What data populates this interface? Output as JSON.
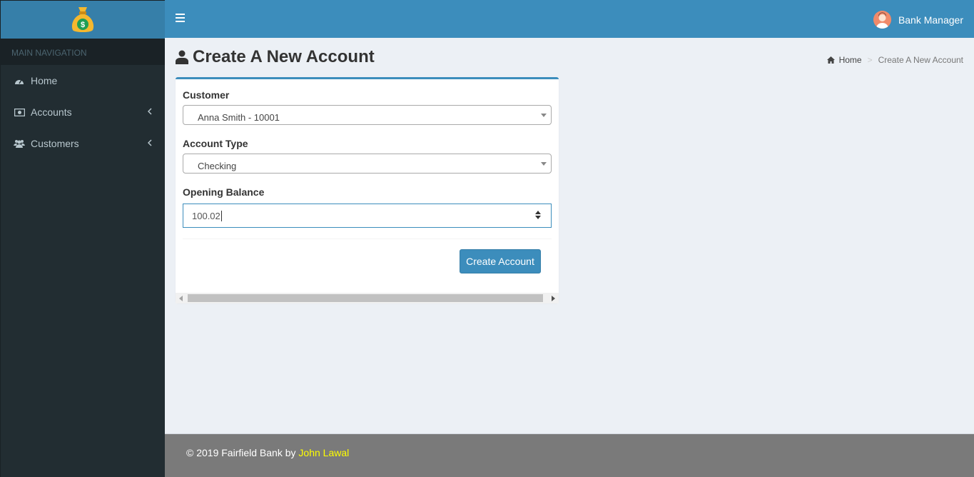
{
  "sidebar": {
    "nav_header": "MAIN NAVIGATION",
    "items": [
      {
        "label": "Home",
        "icon": "dashboard-icon"
      },
      {
        "label": "Accounts",
        "icon": "money-icon"
      },
      {
        "label": "Customers",
        "icon": "users-icon"
      }
    ]
  },
  "header": {
    "user_name": "Bank Manager"
  },
  "page": {
    "title": "Create A New Account",
    "breadcrumb": {
      "home": "Home",
      "separator": ">",
      "current": "Create A New Account"
    }
  },
  "form": {
    "customer_label": "Customer",
    "customer_value": "Anna Smith - 10001",
    "account_type_label": "Account Type",
    "account_type_value": "Checking",
    "opening_balance_label": "Opening Balance",
    "opening_balance_value": "100.02",
    "submit_label": "Create Account"
  },
  "footer": {
    "copyright": "© 2019 Fairfield Bank by ",
    "author": "John Lawal"
  },
  "colors": {
    "primary": "#3c8dbc",
    "sidebar": "#222d32",
    "footer": "#7a7a7a",
    "author_link": "#ffff00"
  }
}
